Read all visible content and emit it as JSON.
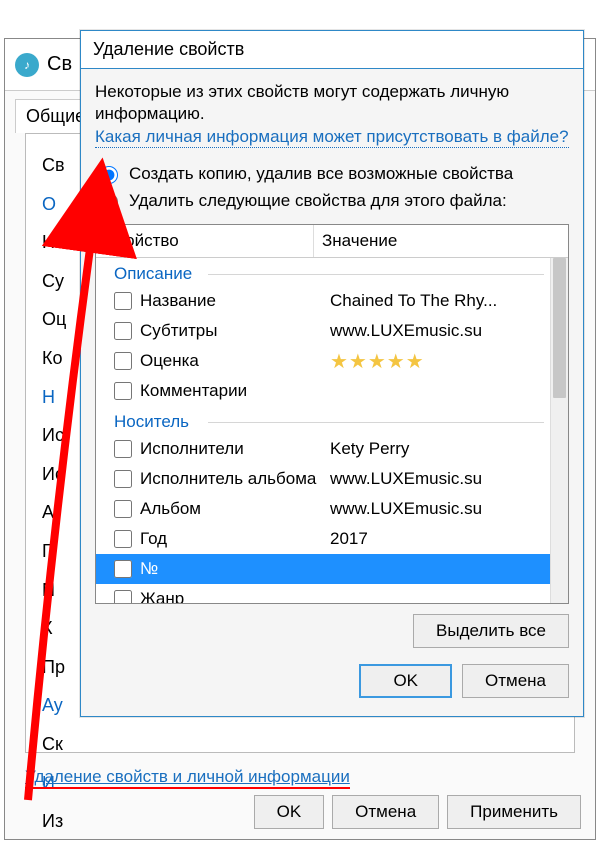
{
  "back_dialog": {
    "title": "Св",
    "tab": "Общие",
    "labels": [
      "Св",
      "О",
      "На",
      "Су",
      "Оц",
      "Ко",
      "Н",
      "Ис",
      "Ис",
      "А",
      "Г",
      "N",
      "К",
      "Пр",
      "Ау",
      "Ск",
      "И",
      "Из"
    ],
    "blue_indices": [
      1,
      6,
      14,
      16
    ],
    "link_text": "Удаление свойств и личной информации",
    "buttons": {
      "ok": "OK",
      "cancel": "Отмена",
      "apply": "Применить"
    }
  },
  "front_dialog": {
    "title": "Удаление свойств",
    "intro": "Некоторые из этих свойств могут содержать личную информацию.",
    "info_link": "Какая личная информация может присутствовать в файле?",
    "radio1": "Создать копию, удалив все возможные свойства",
    "radio2": "Удалить следующие свойства для этого файла:",
    "radio_selected": 1,
    "headers": {
      "property": "Свойство",
      "value": "Значение"
    },
    "groups": [
      {
        "name": "Описание",
        "items": [
          {
            "prop": "Название",
            "val": "Chained To The Rhy..."
          },
          {
            "prop": "Субтитры",
            "val": "www.LUXEmusic.su"
          },
          {
            "prop": "Оценка",
            "val": "★★★★★",
            "stars": true
          },
          {
            "prop": "Комментарии",
            "val": ""
          }
        ]
      },
      {
        "name": "Носитель",
        "items": [
          {
            "prop": "Исполнители",
            "val": "Kety Perry"
          },
          {
            "prop": "Исполнитель альбома",
            "val": "www.LUXEmusic.su"
          },
          {
            "prop": "Альбом",
            "val": "www.LUXEmusic.su"
          },
          {
            "prop": "Год",
            "val": "2017"
          },
          {
            "prop": "№",
            "val": "",
            "selected": true
          },
          {
            "prop": "Жанр",
            "val": ""
          }
        ]
      }
    ],
    "select_all": "Выделить все",
    "buttons": {
      "ok": "OK",
      "cancel": "Отмена"
    }
  }
}
